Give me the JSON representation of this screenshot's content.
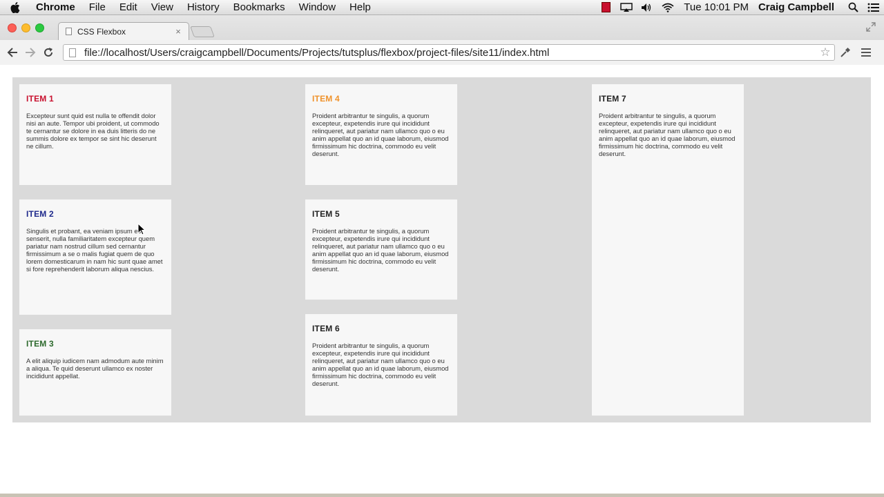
{
  "menubar": {
    "app_name": "Chrome",
    "items": [
      "File",
      "Edit",
      "View",
      "History",
      "Bookmarks",
      "Window",
      "Help"
    ],
    "clock": "Tue 10:01 PM",
    "user": "Craig Campbell"
  },
  "browser": {
    "tab_title": "CSS Flexbox",
    "tab_close": "×",
    "url": "file://localhost/Users/craigcampbell/Documents/Projects/tutsplus/flexbox/project-files/site11/index.html"
  },
  "items": [
    {
      "title": "ITEM 1",
      "color": "#c8102e",
      "text": "Excepteur sunt quid est nulla te offendit dolor nisi an aute. Tempor ubi proident, ut commodo te cernantur se dolore in ea duis litteris do ne summis dolore ex tempor se sint hic deserunt ne cillum."
    },
    {
      "title": "ITEM 2",
      "color": "#1f2a8c",
      "text": "Singulis et probant, ea veniam ipsum est senserit, nulla familiaritatem excepteur quem pariatur nam nostrud cillum sed cernantur firmissimum a se o malis fugiat quem de quo lorem domesticarum in nam hic sunt quae amet si fore reprehenderit laborum aliqua nescius."
    },
    {
      "title": "ITEM 3",
      "color": "#2d6a2d",
      "text": "A elit aliquip iudicem nam admodum aute minim a aliqua. Te quid deserunt ullamco ex noster incididunt appellat."
    },
    {
      "title": "ITEM 4",
      "color": "#f0922b",
      "text": "Proident arbitrantur te singulis, a quorum excepteur, expetendis irure qui incididunt relinqueret, aut pariatur nam ullamco quo o eu anim appellat quo an id quae laborum, eiusmod firmissimum hic doctrina, commodo eu velit deserunt."
    },
    {
      "title": "ITEM 5",
      "color": "#222222",
      "text": "Proident arbitrantur te singulis, a quorum excepteur, expetendis irure qui incididunt relinqueret, aut pariatur nam ullamco quo o eu anim appellat quo an id quae laborum, eiusmod firmissimum hic doctrina, commodo eu velit deserunt."
    },
    {
      "title": "ITEM 6",
      "color": "#222222",
      "text": "Proident arbitrantur te singulis, a quorum excepteur, expetendis irure qui incididunt relinqueret, aut pariatur nam ullamco quo o eu anim appellat quo an id quae laborum, eiusmod firmissimum hic doctrina, commodo eu velit deserunt."
    },
    {
      "title": "ITEM 7",
      "color": "#222222",
      "text": "Proident arbitrantur te singulis, a quorum excepteur, expetendis irure qui incididunt relinqueret, aut pariatur nam ullamco quo o eu anim appellat quo an id quae laborum, eiusmod firmissimum hic doctrina, commodo eu velit deserunt."
    }
  ]
}
